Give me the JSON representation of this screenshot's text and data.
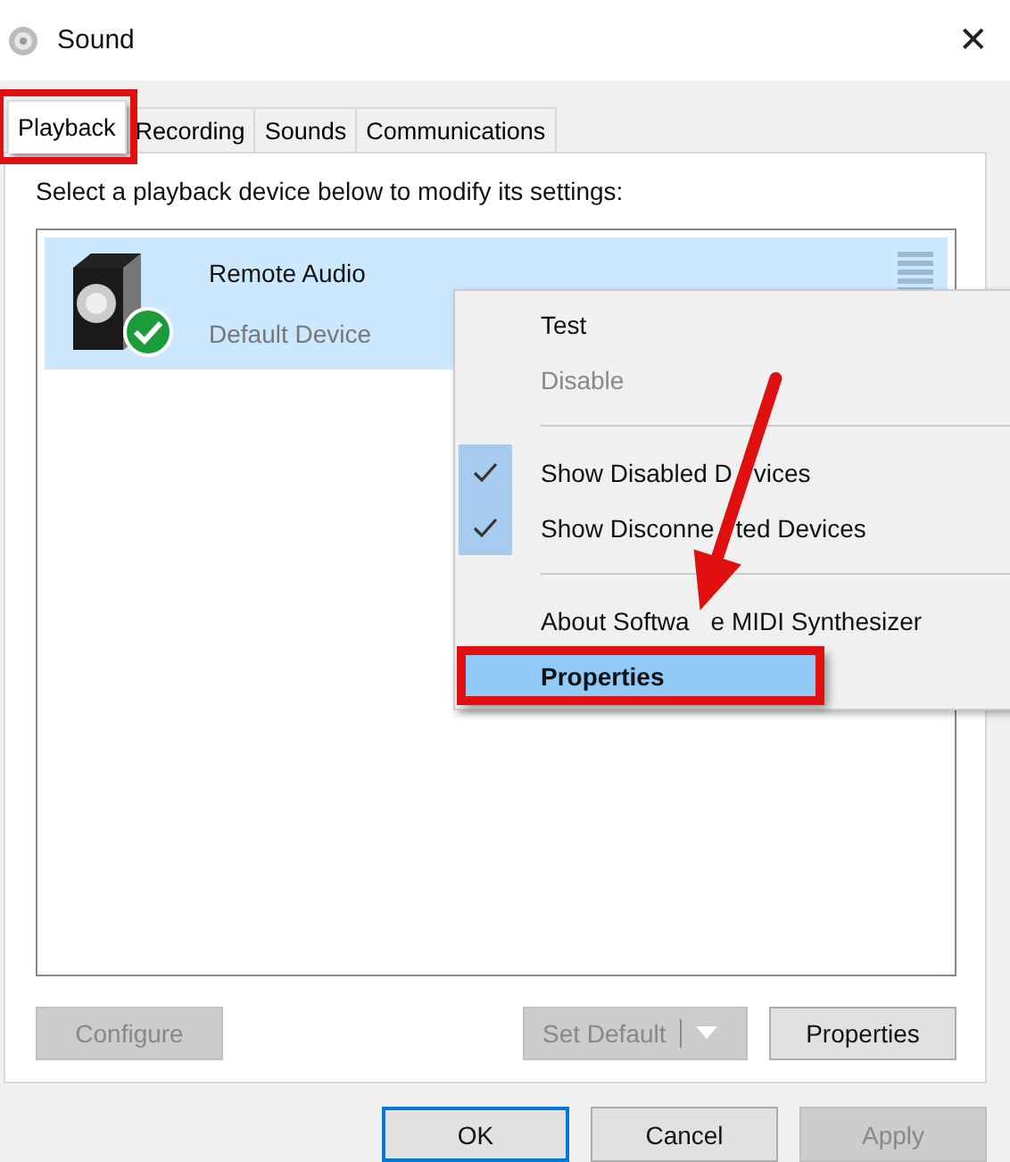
{
  "window": {
    "title": "Sound",
    "close": "✕"
  },
  "tabs": [
    {
      "label": "Playback",
      "selected": true,
      "callout": true
    },
    {
      "label": "Recording",
      "selected": false,
      "callout": false
    },
    {
      "label": "Sounds",
      "selected": false,
      "callout": false
    },
    {
      "label": "Communications",
      "selected": false,
      "callout": false
    }
  ],
  "instruction": "Select a playback device below to modify its settings:",
  "devices": [
    {
      "name": "Remote Audio",
      "status": "Default Device",
      "selected": true,
      "default": true
    }
  ],
  "context_menu": [
    {
      "kind": "item",
      "label": [
        "Test"
      ],
      "disabled": false,
      "checked": false,
      "selected": false,
      "bold": false,
      "callout": false
    },
    {
      "kind": "item",
      "label": [
        "Disable"
      ],
      "disabled": true,
      "checked": false,
      "selected": false,
      "bold": false,
      "callout": false
    },
    {
      "kind": "separator"
    },
    {
      "kind": "item",
      "label": [
        "Show Disabled D",
        "vices"
      ],
      "disabled": false,
      "checked": true,
      "selected": false,
      "bold": false,
      "callout": false
    },
    {
      "kind": "item",
      "label": [
        "Show Disconne",
        "ted Devices"
      ],
      "disabled": false,
      "checked": true,
      "selected": false,
      "bold": false,
      "callout": false
    },
    {
      "kind": "separator"
    },
    {
      "kind": "item",
      "label": [
        "About Softwa",
        "e MIDI Synthesizer"
      ],
      "disabled": false,
      "checked": false,
      "selected": false,
      "bold": false,
      "callout": false
    },
    {
      "kind": "item",
      "label": [
        "Properties"
      ],
      "disabled": false,
      "checked": false,
      "selected": true,
      "bold": true,
      "callout": true
    }
  ],
  "annotations": [
    {
      "kind": "arrow"
    }
  ],
  "device_buttons": [
    {
      "kind": "plain",
      "label": "Configure",
      "disabled": true
    },
    {
      "kind": "spacer"
    },
    {
      "kind": "split",
      "label": "Set Default",
      "disabled": true
    },
    {
      "kind": "plain",
      "label": "Properties",
      "disabled": false
    }
  ],
  "dialog_buttons": [
    {
      "label": "OK",
      "disabled": false,
      "focused": true
    },
    {
      "label": "Cancel",
      "disabled": false,
      "focused": false
    },
    {
      "label": "Apply",
      "disabled": true,
      "focused": false
    }
  ]
}
